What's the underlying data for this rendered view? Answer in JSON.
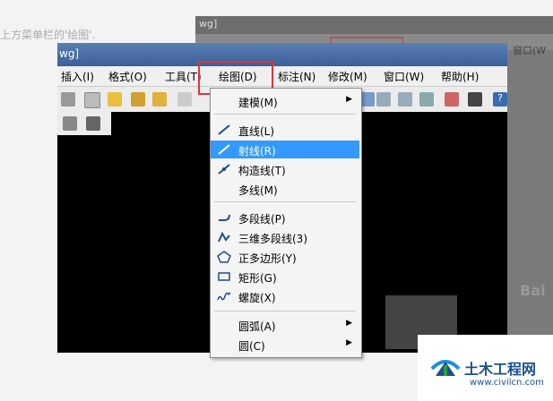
{
  "background_caption": "上方菜单栏的'绘图'.",
  "ghost": {
    "title": "wg]",
    "right_menu": "窗口(W"
  },
  "window": {
    "title": "wg]"
  },
  "menubar": [
    "插入(I)",
    "格式(O)",
    "工具(T)",
    "绘图(D)",
    "标注(N)",
    "修改(M)",
    "窗口(W)",
    "帮助(H)"
  ],
  "dropdown": {
    "items": [
      {
        "label": "建模(M)",
        "icon": "none",
        "submenu": true
      },
      {
        "label": "直线(L)",
        "icon": "line-icon"
      },
      {
        "label": "射线(R)",
        "icon": "ray-icon",
        "selected": true
      },
      {
        "label": "构造线(T)",
        "icon": "construction-line-icon"
      },
      {
        "label": "多线(M)",
        "icon": "none"
      },
      {
        "label": "多段线(P)",
        "icon": "polyline-icon"
      },
      {
        "label": "三维多段线(3)",
        "icon": "3d-polyline-icon"
      },
      {
        "label": "正多边形(Y)",
        "icon": "polygon-icon"
      },
      {
        "label": "矩形(G)",
        "icon": "rectangle-icon"
      },
      {
        "label": "螺旋(X)",
        "icon": "helix-icon"
      },
      {
        "label": "圆弧(A)",
        "icon": "none",
        "submenu": true
      },
      {
        "label": "圆(C)",
        "icon": "none",
        "submenu": true
      }
    ]
  },
  "watermark": {
    "bai": "Bai"
  },
  "logo": {
    "name": "土木工程网",
    "url": "www.civilcn.com"
  },
  "colors": {
    "highlight": "#e53333",
    "selection": "#3399ff",
    "brand": "#1d4f8f"
  }
}
